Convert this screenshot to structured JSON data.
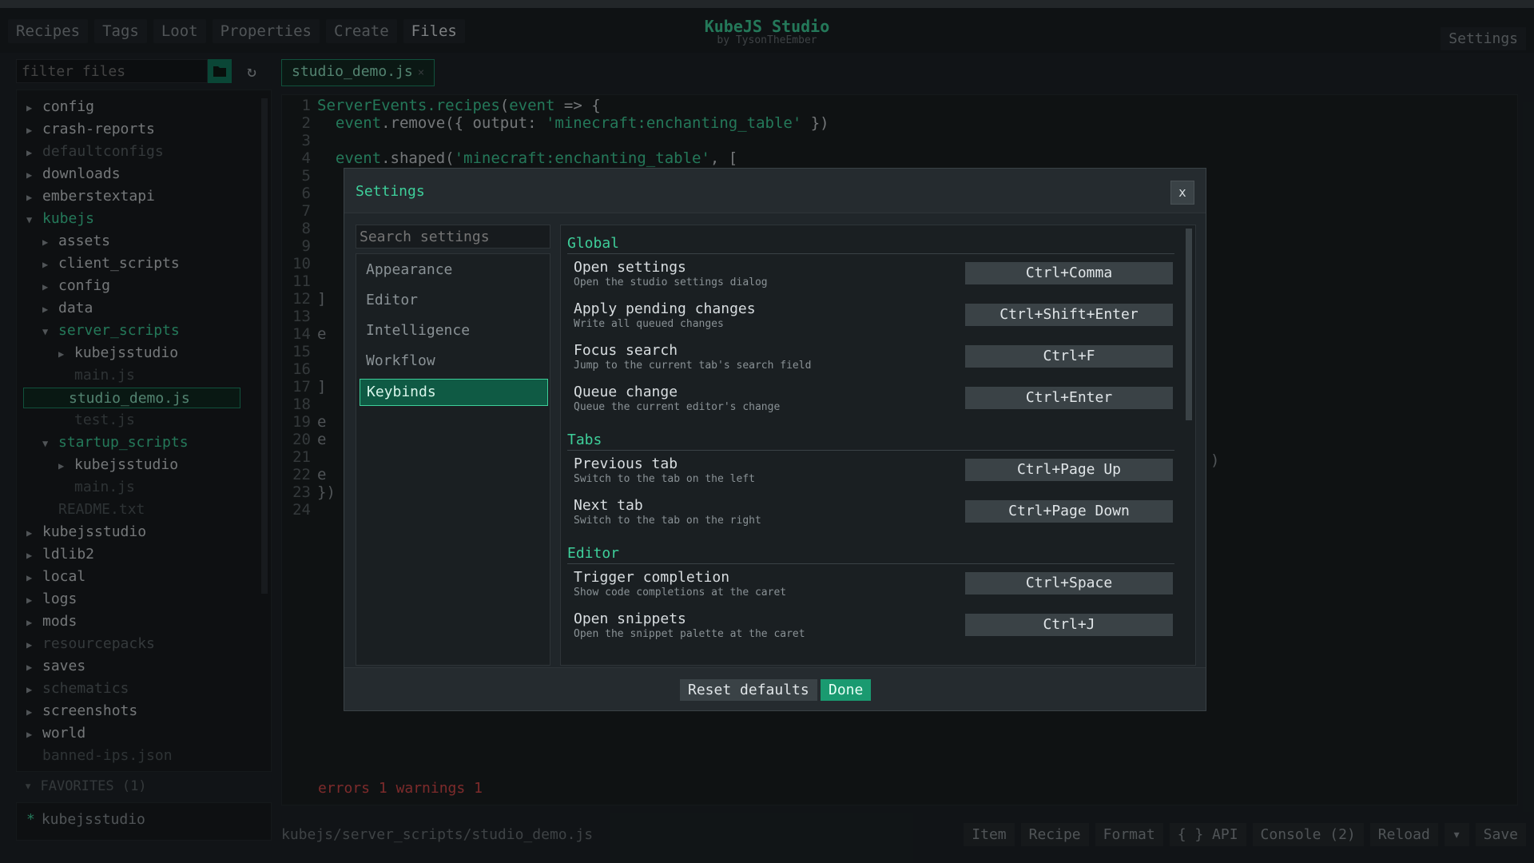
{
  "app": {
    "title": "KubeJS Studio",
    "subtitle": "by TysonTheEmber"
  },
  "nav": [
    "Recipes",
    "Tags",
    "Loot",
    "Properties",
    "Create",
    "Files"
  ],
  "settings_label": "Settings",
  "filter": {
    "placeholder": "filter files"
  },
  "tree": [
    {
      "label": "config",
      "depth": 0,
      "kind": "folder",
      "state": "normal"
    },
    {
      "label": "crash-reports",
      "depth": 0,
      "kind": "folder",
      "state": "normal"
    },
    {
      "label": "defaultconfigs",
      "depth": 0,
      "kind": "folder",
      "state": "dim"
    },
    {
      "label": "downloads",
      "depth": 0,
      "kind": "folder",
      "state": "normal"
    },
    {
      "label": "emberstextapi",
      "depth": 0,
      "kind": "folder",
      "state": "normal"
    },
    {
      "label": "kubejs",
      "depth": 0,
      "kind": "folder-open",
      "state": "green"
    },
    {
      "label": "assets",
      "depth": 1,
      "kind": "folder",
      "state": "normal"
    },
    {
      "label": "client_scripts",
      "depth": 1,
      "kind": "folder",
      "state": "normal"
    },
    {
      "label": "config",
      "depth": 1,
      "kind": "folder",
      "state": "normal"
    },
    {
      "label": "data",
      "depth": 1,
      "kind": "folder",
      "state": "normal"
    },
    {
      "label": "server_scripts",
      "depth": 1,
      "kind": "folder-open",
      "state": "green"
    },
    {
      "label": "kubejsstudio",
      "depth": 2,
      "kind": "folder",
      "state": "normal"
    },
    {
      "label": "main.js",
      "depth": 2,
      "kind": "file",
      "state": "dimfile"
    },
    {
      "label": "studio_demo.js",
      "depth": 2,
      "kind": "file",
      "state": "selected"
    },
    {
      "label": "test.js",
      "depth": 2,
      "kind": "file",
      "state": "dimfile"
    },
    {
      "label": "startup_scripts",
      "depth": 1,
      "kind": "folder-open",
      "state": "green"
    },
    {
      "label": "kubejsstudio",
      "depth": 2,
      "kind": "folder",
      "state": "normal"
    },
    {
      "label": "main.js",
      "depth": 2,
      "kind": "file",
      "state": "dimfile"
    },
    {
      "label": "README.txt",
      "depth": 1,
      "kind": "file",
      "state": "dimfile"
    },
    {
      "label": "kubejsstudio",
      "depth": 0,
      "kind": "folder",
      "state": "normal"
    },
    {
      "label": "ldlib2",
      "depth": 0,
      "kind": "folder",
      "state": "normal"
    },
    {
      "label": "local",
      "depth": 0,
      "kind": "folder",
      "state": "normal"
    },
    {
      "label": "logs",
      "depth": 0,
      "kind": "folder",
      "state": "normal"
    },
    {
      "label": "mods",
      "depth": 0,
      "kind": "folder",
      "state": "normal"
    },
    {
      "label": "resourcepacks",
      "depth": 0,
      "kind": "folder",
      "state": "dim"
    },
    {
      "label": "saves",
      "depth": 0,
      "kind": "folder",
      "state": "normal"
    },
    {
      "label": "schematics",
      "depth": 0,
      "kind": "folder",
      "state": "dim"
    },
    {
      "label": "screenshots",
      "depth": 0,
      "kind": "folder",
      "state": "normal"
    },
    {
      "label": "world",
      "depth": 0,
      "kind": "folder",
      "state": "normal"
    },
    {
      "label": "banned-ips.json",
      "depth": 0,
      "kind": "file",
      "state": "dimfile"
    }
  ],
  "favorites": {
    "header": "FAVORITES (1)",
    "items": [
      "kubejsstudio"
    ]
  },
  "editor": {
    "tab": "studio_demo.js",
    "line_numbers": [
      "1",
      "2",
      "3",
      "4",
      "5",
      "6",
      "7",
      "8",
      "9",
      "10",
      "11",
      "12",
      "13",
      "14",
      "15",
      "16",
      "17",
      "18",
      "19",
      "20",
      "21",
      "22",
      "23",
      "24"
    ],
    "code": [
      {
        "n": 1,
        "parts": [
          [
            "kw",
            "ServerEvents.recipes"
          ],
          [
            "plain",
            "("
          ],
          [
            "kw",
            "event"
          ],
          [
            "plain",
            " => {"
          ]
        ]
      },
      {
        "n": 2,
        "parts": [
          [
            "kw",
            "  event"
          ],
          [
            "plain",
            ".remove({ output: "
          ],
          [
            "str",
            "'minecraft:enchanting_table'"
          ],
          [
            "plain",
            " })"
          ]
        ]
      },
      {
        "n": 4,
        "parts": [
          [
            "kw",
            "  event"
          ],
          [
            "plain",
            ".shaped("
          ],
          [
            "str",
            "'minecraft:enchanting_table'"
          ],
          [
            "plain",
            ", ["
          ]
        ]
      }
    ],
    "peek_lines": [
      {
        "n": 12,
        "text": "]"
      },
      {
        "n": 14,
        "text": "e"
      },
      {
        "n": 17,
        "text": "]"
      },
      {
        "n": 19,
        "text": "e"
      },
      {
        "n": 20,
        "text": "e"
      },
      {
        "n": 22,
        "text": "e"
      },
      {
        "n": 23,
        "text": "})"
      }
    ],
    "right_paren": ")",
    "issues": "errors 1  warnings 1",
    "path": "kubejs/server_scripts/studio_demo.js"
  },
  "actions": [
    "Item",
    "Recipe",
    "Format",
    "{ } API",
    "Console (2)",
    "Reload",
    "▾",
    "Save"
  ],
  "dialog": {
    "title": "Settings",
    "close": "x",
    "search_placeholder": "Search settings",
    "nav": [
      "Appearance",
      "Editor",
      "Intelligence",
      "Workflow",
      "Keybinds"
    ],
    "active_nav": "Keybinds",
    "sections": [
      {
        "title": "Global",
        "items": [
          {
            "title": "Open settings",
            "desc": "Open the studio settings dialog",
            "key": "Ctrl+Comma"
          },
          {
            "title": "Apply pending changes",
            "desc": "Write all queued changes",
            "key": "Ctrl+Shift+Enter"
          },
          {
            "title": "Focus search",
            "desc": "Jump to the current tab's search field",
            "key": "Ctrl+F"
          },
          {
            "title": "Queue change",
            "desc": "Queue the current editor's change",
            "key": "Ctrl+Enter"
          }
        ]
      },
      {
        "title": "Tabs",
        "items": [
          {
            "title": "Previous tab",
            "desc": "Switch to the tab on the left",
            "key": "Ctrl+Page Up"
          },
          {
            "title": "Next tab",
            "desc": "Switch to the tab on the right",
            "key": "Ctrl+Page Down"
          }
        ]
      },
      {
        "title": "Editor",
        "items": [
          {
            "title": "Trigger completion",
            "desc": "Show code completions at the caret",
            "key": "Ctrl+Space"
          },
          {
            "title": "Open snippets",
            "desc": "Open the snippet palette at the caret",
            "key": "Ctrl+J"
          }
        ]
      }
    ],
    "reset_label": "Reset defaults",
    "done_label": "Done"
  },
  "colors": {
    "accent": "#3ecf9a",
    "error": "#d84a4a",
    "background": "#1e2428"
  }
}
